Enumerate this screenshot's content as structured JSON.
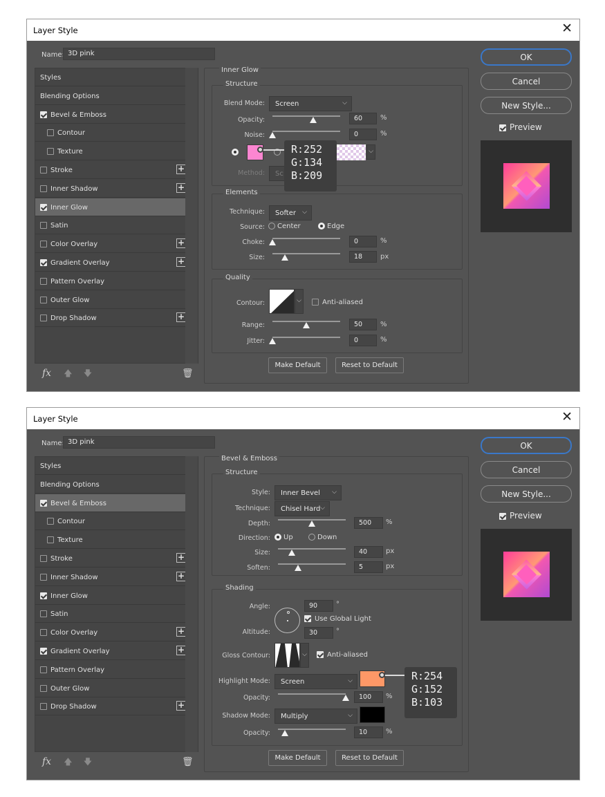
{
  "dialog1": {
    "title": "Layer Style",
    "close": "✕",
    "name_label": "Name:",
    "name_value": "3D pink",
    "styles": [
      {
        "label": "Styles",
        "check": "none",
        "plus": false,
        "sub": false,
        "selected": false
      },
      {
        "label": "Blending Options",
        "check": "none",
        "plus": false,
        "sub": false,
        "selected": false
      },
      {
        "label": "Bevel & Emboss",
        "check": "on",
        "plus": false,
        "sub": false,
        "selected": false
      },
      {
        "label": "Contour",
        "check": "off",
        "plus": false,
        "sub": true,
        "selected": false
      },
      {
        "label": "Texture",
        "check": "off",
        "plus": false,
        "sub": true,
        "selected": false
      },
      {
        "label": "Stroke",
        "check": "off",
        "plus": true,
        "sub": false,
        "selected": false
      },
      {
        "label": "Inner Shadow",
        "check": "off",
        "plus": true,
        "sub": false,
        "selected": false
      },
      {
        "label": "Inner Glow",
        "check": "on",
        "plus": false,
        "sub": false,
        "selected": true
      },
      {
        "label": "Satin",
        "check": "off",
        "plus": false,
        "sub": false,
        "selected": false
      },
      {
        "label": "Color Overlay",
        "check": "off",
        "plus": true,
        "sub": false,
        "selected": false
      },
      {
        "label": "Gradient Overlay",
        "check": "on",
        "plus": true,
        "sub": false,
        "selected": false
      },
      {
        "label": "Pattern Overlay",
        "check": "off",
        "plus": false,
        "sub": false,
        "selected": false
      },
      {
        "label": "Outer Glow",
        "check": "off",
        "plus": false,
        "sub": false,
        "selected": false
      },
      {
        "label": "Drop Shadow",
        "check": "off",
        "plus": true,
        "sub": false,
        "selected": false
      }
    ],
    "section_title": "Inner Glow",
    "structure": {
      "title": "Structure",
      "blend_mode_label": "Blend Mode:",
      "blend_mode_value": "Screen",
      "opacity_label": "Opacity:",
      "opacity_value": "60",
      "opacity_level": 60,
      "opacity_unit": "%",
      "noise_label": "Noise:",
      "noise_value": "0",
      "noise_level": 0,
      "noise_unit": "%",
      "color_hex": "#fc86d1",
      "method_label": "Method:",
      "method_value": "Sc"
    },
    "tooltip": {
      "r": "R:252",
      "g": "G:134",
      "b": "B:209"
    },
    "elements": {
      "title": "Elements",
      "technique_label": "Technique:",
      "technique_value": "Softer",
      "source_label": "Source:",
      "source_center": "Center",
      "source_edge": "Edge",
      "source_selected": "Edge",
      "choke_label": "Choke:",
      "choke_value": "0",
      "choke_level": 0,
      "choke_unit": "%",
      "size_label": "Size:",
      "size_value": "18",
      "size_level": 18,
      "size_unit": "px"
    },
    "quality": {
      "title": "Quality",
      "contour_label": "Contour:",
      "anti_aliased_label": "Anti-aliased",
      "anti_aliased": false,
      "range_label": "Range:",
      "range_value": "50",
      "range_level": 50,
      "range_unit": "%",
      "jitter_label": "Jitter:",
      "jitter_value": "0",
      "jitter_level": 0,
      "jitter_unit": "%"
    },
    "make_default": "Make Default",
    "reset_default": "Reset to Default",
    "ok": "OK",
    "cancel": "Cancel",
    "new_style": "New Style...",
    "preview_label": "Preview",
    "preview_checked": true
  },
  "dialog2": {
    "title": "Layer Style",
    "close": "✕",
    "name_label": "Name:",
    "name_value": "3D pink",
    "styles": [
      {
        "label": "Styles",
        "check": "none",
        "plus": false,
        "sub": false,
        "selected": false
      },
      {
        "label": "Blending Options",
        "check": "none",
        "plus": false,
        "sub": false,
        "selected": false
      },
      {
        "label": "Bevel & Emboss",
        "check": "on",
        "plus": false,
        "sub": false,
        "selected": true
      },
      {
        "label": "Contour",
        "check": "off",
        "plus": false,
        "sub": true,
        "selected": false
      },
      {
        "label": "Texture",
        "check": "off",
        "plus": false,
        "sub": true,
        "selected": false
      },
      {
        "label": "Stroke",
        "check": "off",
        "plus": true,
        "sub": false,
        "selected": false
      },
      {
        "label": "Inner Shadow",
        "check": "off",
        "plus": true,
        "sub": false,
        "selected": false
      },
      {
        "label": "Inner Glow",
        "check": "on",
        "plus": false,
        "sub": false,
        "selected": false
      },
      {
        "label": "Satin",
        "check": "off",
        "plus": false,
        "sub": false,
        "selected": false
      },
      {
        "label": "Color Overlay",
        "check": "off",
        "plus": true,
        "sub": false,
        "selected": false
      },
      {
        "label": "Gradient Overlay",
        "check": "on",
        "plus": true,
        "sub": false,
        "selected": false
      },
      {
        "label": "Pattern Overlay",
        "check": "off",
        "plus": false,
        "sub": false,
        "selected": false
      },
      {
        "label": "Outer Glow",
        "check": "off",
        "plus": false,
        "sub": false,
        "selected": false
      },
      {
        "label": "Drop Shadow",
        "check": "off",
        "plus": true,
        "sub": false,
        "selected": false
      }
    ],
    "section_title": "Bevel & Emboss",
    "structure": {
      "title": "Structure",
      "style_label": "Style:",
      "style_value": "Inner Bevel",
      "technique_label": "Technique:",
      "technique_value": "Chisel Hard",
      "depth_label": "Depth:",
      "depth_value": "500",
      "depth_level": 50,
      "depth_unit": "%",
      "direction_label": "Direction:",
      "direction_up": "Up",
      "direction_down": "Down",
      "direction_selected": "Up",
      "size_label": "Size:",
      "size_value": "40",
      "size_level": 20,
      "size_unit": "px",
      "soften_label": "Soften:",
      "soften_value": "5",
      "soften_level": 30,
      "soften_unit": "px"
    },
    "shading": {
      "title": "Shading",
      "angle_label": "Angle:",
      "angle_value": "90",
      "angle_unit": "°",
      "use_global_light": "Use Global Light",
      "use_global_light_checked": true,
      "altitude_label": "Altitude:",
      "altitude_value": "30",
      "altitude_unit": "°",
      "gloss_label": "Gloss Contour:",
      "anti_aliased_label": "Anti-aliased",
      "anti_aliased": true,
      "highlight_mode_label": "Highlight Mode:",
      "highlight_mode_value": "Screen",
      "highlight_color": "#fe9867",
      "highlight_opacity_label": "Opacity:",
      "highlight_opacity_value": "100",
      "highlight_opacity_level": 100,
      "highlight_opacity_unit": "%",
      "shadow_mode_label": "Shadow Mode:",
      "shadow_mode_value": "Multiply",
      "shadow_color": "#000000",
      "shadow_opacity_label": "Opacity:",
      "shadow_opacity_value": "10",
      "shadow_opacity_level": 10,
      "shadow_opacity_unit": "%"
    },
    "tooltip": {
      "r": "R:254",
      "g": "G:152",
      "b": "B:103"
    },
    "make_default": "Make Default",
    "reset_default": "Reset to Default",
    "ok": "OK",
    "cancel": "Cancel",
    "new_style": "New Style...",
    "preview_label": "Preview",
    "preview_checked": true
  }
}
